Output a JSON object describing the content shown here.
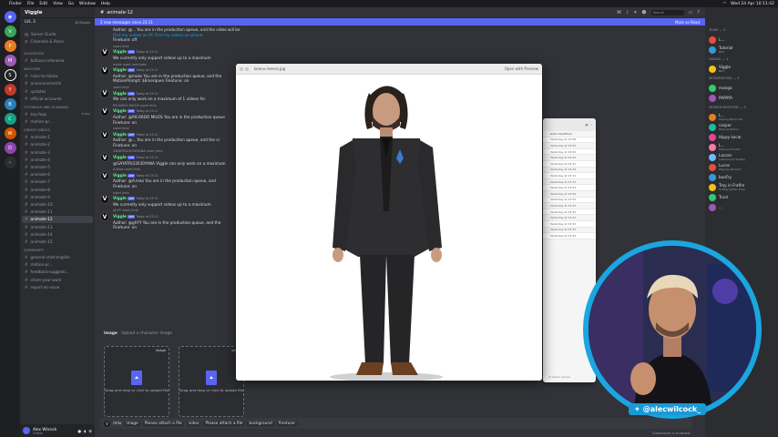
{
  "menubar": {
    "apple": "",
    "items": [
      "Finder",
      "File",
      "Edit",
      "View",
      "Go",
      "Window",
      "Help"
    ],
    "clock": "Wed 24 Apr 10:11:42"
  },
  "servers": [
    "V",
    "P",
    "M",
    "S",
    "Y",
    "B",
    "C",
    "W",
    "D",
    "+"
  ],
  "sidebar": {
    "server_name": "Viggle",
    "boost": "LVL 3",
    "boosts": "38 Boosts",
    "top_items": [
      "Server Guide",
      "Channels & Roles"
    ],
    "categories": [
      {
        "name": "SUGGESTED",
        "channels": [
          "bahasa-indonesia"
        ]
      },
      {
        "name": "WELCOME",
        "channels": [
          "rules-to-follow",
          "announcements",
          "updates",
          "official-accounts"
        ]
      },
      {
        "name": "TUTORIALS AND GUIDANCE",
        "channels": [
          "key-faqs",
          "motion-pr..."
        ]
      },
      {
        "name": "CREATE VIDEOS",
        "channels": [
          "animate-1",
          "animate-2",
          "animate-3",
          "animate-4",
          "animate-5",
          "animate-6",
          "animate-7",
          "animate-8",
          "animate-9",
          "animate-10",
          "animate-11",
          "animate-12",
          "animate-13",
          "animate-14",
          "animate-15"
        ]
      },
      {
        "name": "COMMUNITY",
        "channels": [
          "general-chat-english",
          "motion-pr...",
          "feedback-suggesti...",
          "share-your-work",
          "report-an-issue"
        ]
      }
    ],
    "badges": {
      "key-faqs": "5 New",
      "motion-pr...": "20 New"
    }
  },
  "user": {
    "name": "Alex Wilcock",
    "status": "Online"
  },
  "chat": {
    "channel": "animate-12",
    "search_placeholder": "Search",
    "new_messages": "2 new messages since 23:11",
    "mark_read": "Mark as Read",
    "messages": [
      {
        "reply": "",
        "author": "",
        "text": "Author: @... You are in the production queue, and the video will be displayed at this message in 2-5 minutes.",
        "links": "Find my videos on PC  Find my videos on phone",
        "extra": "Finetune: off"
      },
      {
        "reply": "used /mix",
        "author": "Viggle",
        "time": "Today at 23:11",
        "text": "We currently only support videos up to a maximum",
        "extra": ""
      },
      {
        "reply": "maks used /animate",
        "author": "Viggle",
        "time": "Today at 23:11",
        "text": "Author: @maks You are in the production queue, and the",
        "extra": "MotionPrompt: $Emerquen  Finetune: on"
      },
      {
        "reply": "used /mix",
        "author": "Viggle",
        "time": "Today at 23:11",
        "text": "We can only work on a maximum of 1 videos for",
        "extra": ""
      },
      {
        "reply": "RICARDO MILOS used /mix",
        "author": "Viggle",
        "time": "Today at 23:11",
        "text": "Author: @RICARDO MILOS You are in the production queue",
        "extra": "Finetune: on"
      },
      {
        "reply": "used /mix",
        "author": "Viggle",
        "time": "Today at 23:11",
        "text": "Author: @... You are in the production queue, and the vi",
        "extra": "Finetune: on"
      },
      {
        "reply": "GAYATRI23030YANA used /mix",
        "author": "Viggle",
        "time": "Today at 23:11",
        "text": "@GAYATRI23030YANA Viggle can only work on a maximum",
        "extra": ""
      },
      {
        "reply": "A.leaa used /mix",
        "author": "Viggle",
        "time": "Today at 23:11",
        "text": "Author: @A.leaa You are in the production queue, and",
        "extra": "Finetune: on"
      },
      {
        "reply": "used /mix",
        "author": "Viggle",
        "time": "Today at 23:11",
        "text": "We currently only support videos up to a maximum",
        "extra": ""
      },
      {
        "reply": "ghYY used /mix",
        "author": "Viggle",
        "time": "Today at 23:11",
        "text": "Author: @ghYY You are in the production queue, and the",
        "extra": "Finetune: on"
      }
    ],
    "image_label": "image",
    "image_hint": "Upload a character image",
    "upload1": {
      "corner": "image",
      "text": "Drag and drop or click to upload file"
    },
    "upload2": {
      "corner": "video",
      "text": "Drag and drop or click to upload file"
    },
    "command": "/mix",
    "chips": [
      "image",
      "Please attach a file",
      "video",
      "Please attach a file",
      "background",
      "finetune"
    ],
    "slowmode": "Slowmode is enabled."
  },
  "preview": {
    "title": "keanu reeves.jpg",
    "open_btn": "Open with Preview"
  },
  "finder": {
    "header": "Date Modified",
    "rows": [
      "Yesterday at 23:58",
      "Yesterday at 23:03",
      "Yesterday at 23:06",
      "Yesterday at 23:02",
      "Yesterday at 23:47",
      "Yesterday at 23:44",
      "Yesterday at 23:11",
      "Yesterday at 23:31",
      "Yesterday at 23:23",
      "Yesterday at 23:09",
      "Yesterday at 23:55",
      "Yesterday at 23:22",
      "Yesterday at 23:22",
      "Yesterday at 23:22",
      "Yesterday at 23:22",
      "Yesterday at 23:25",
      "Yesterday at 23:29"
    ],
    "tags": "@ keanu reeves"
  },
  "members": {
    "groups": [
      {
        "name": "TEAM — 3",
        "items": [
          {
            "n": "L...",
            "s": ""
          },
          {
            "n": "Tutorial",
            "s": "BOT"
          }
        ]
      },
      {
        "name": "VIGGLE — 1",
        "items": [
          {
            "n": "Viggle",
            "s": "BOT"
          }
        ]
      },
      {
        "name": "MODERATORS — 3",
        "items": [
          {
            "n": "mango",
            "s": ""
          },
          {
            "n": "PAPAYA",
            "s": ""
          }
        ]
      },
      {
        "name": "SERVER BOOSTER — 9",
        "items": [
          {
            "n": "L...",
            "s": "Playing Minecraft"
          },
          {
            "n": "casper",
            "s": "Playing Roblox"
          },
          {
            "n": "Hippy kocar",
            "s": ""
          },
          {
            "n": "L...",
            "s": "Playing Fortnite"
          },
          {
            "n": "Lacoss",
            "s": "Listening to Spotify"
          },
          {
            "n": "Lucas",
            "s": "Playing Valorant"
          },
          {
            "n": "booFry",
            "s": ""
          },
          {
            "n": "Troy in Frafire",
            "s": "Hoffhg fighter Rush"
          },
          {
            "n": "Trust",
            "s": ""
          },
          {
            "n": "...",
            "s": ""
          }
        ]
      }
    ]
  },
  "cam": {
    "handle": "@alecwilcock_"
  },
  "colors": {
    "accent": "#5865f2",
    "green": "#57f287",
    "camRing": "#1aa6e0"
  }
}
